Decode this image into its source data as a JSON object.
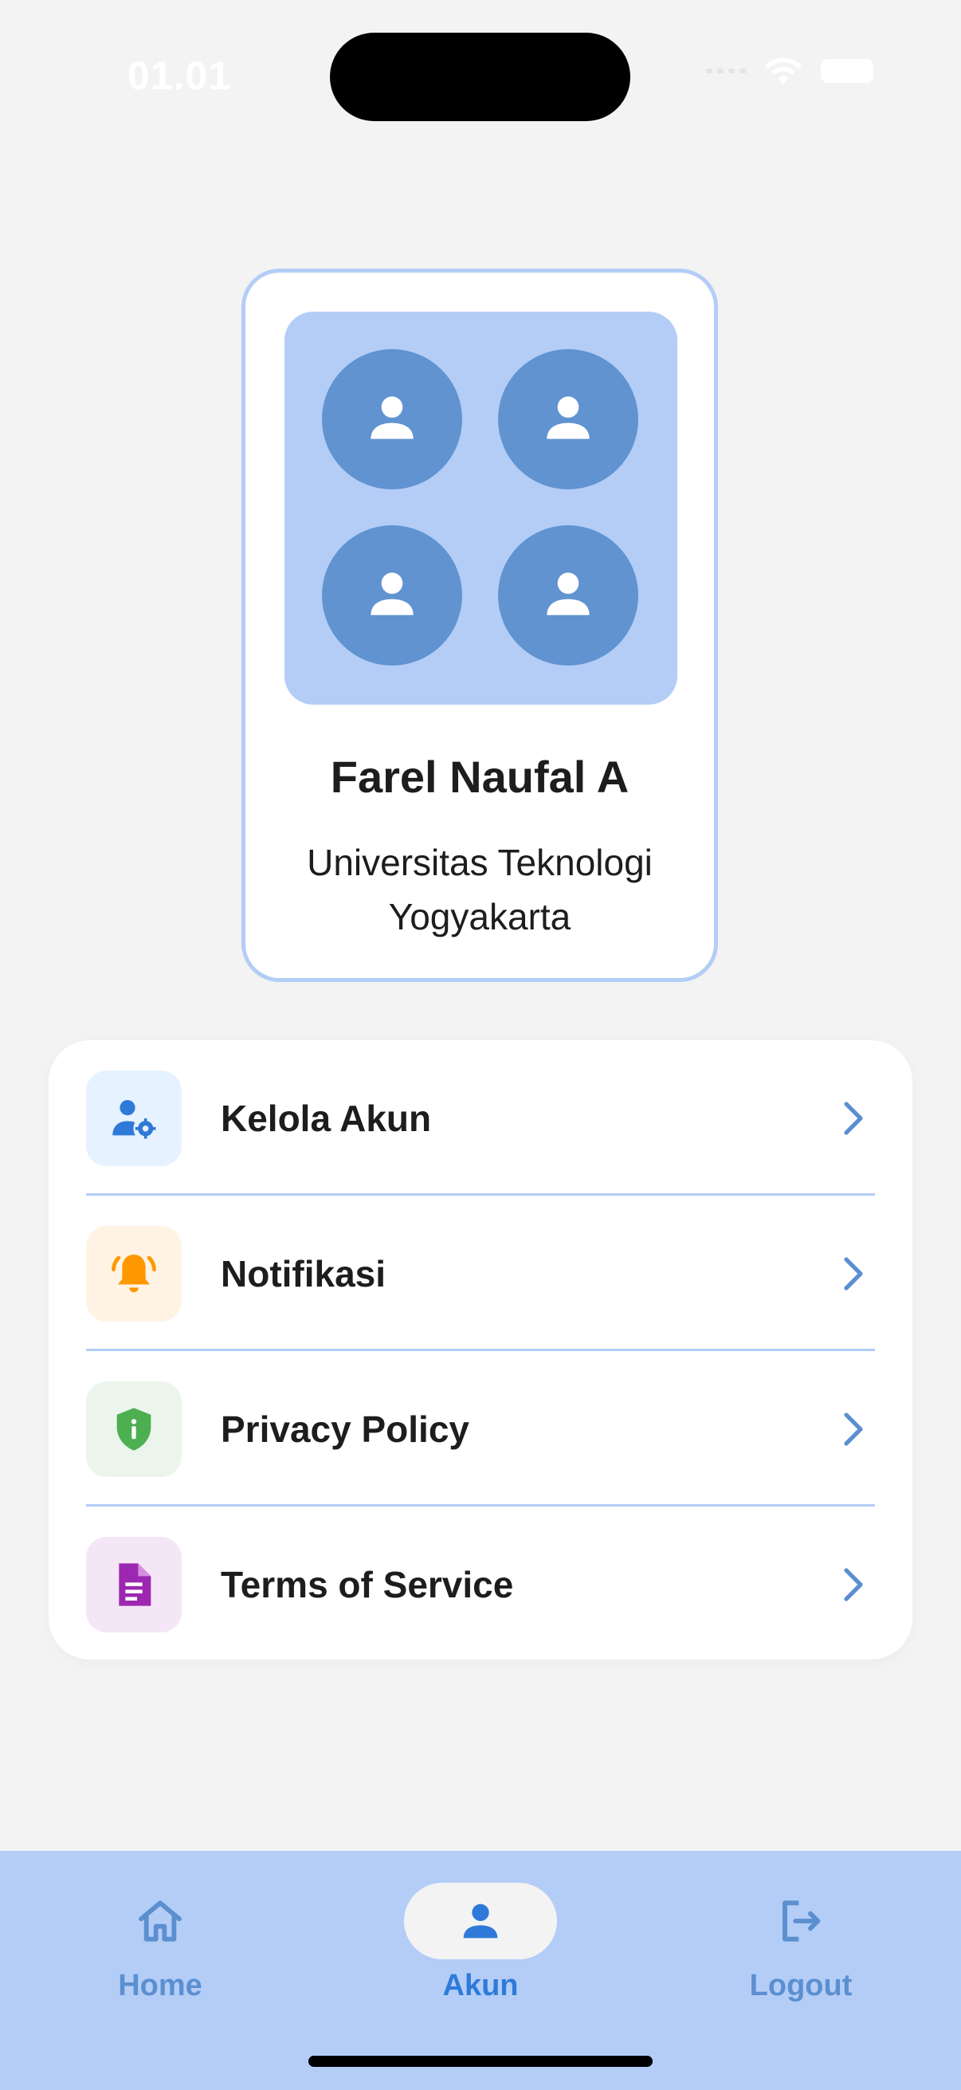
{
  "status_bar": {
    "time": "01.01"
  },
  "profile": {
    "name": "Farel Naufal A",
    "organization": "Universitas Teknologi Yogyakarta"
  },
  "menu": {
    "items": [
      {
        "label": "Kelola Akun",
        "icon": "manage-account-icon",
        "icon_color": "#2f7ad9",
        "bg_color": "#e6f2ff"
      },
      {
        "label": "Notifikasi",
        "icon": "bell-ringing-icon",
        "icon_color": "#ff9800",
        "bg_color": "#fff3e3"
      },
      {
        "label": "Privacy Policy",
        "icon": "shield-info-icon",
        "icon_color": "#4caf50",
        "bg_color": "#ebf5ec"
      },
      {
        "label": "Terms of Service",
        "icon": "document-icon",
        "icon_color": "#9c27b0",
        "bg_color": "#f5e6f7"
      }
    ]
  },
  "bottom_nav": {
    "items": [
      {
        "label": "Home",
        "icon": "home-icon",
        "active": false
      },
      {
        "label": "Akun",
        "icon": "person-icon",
        "active": true
      },
      {
        "label": "Logout",
        "icon": "logout-icon",
        "active": false
      }
    ]
  },
  "colors": {
    "accent": "#b3cdf7",
    "avatar": "#6093d0",
    "chevron": "#5b8fd0",
    "background": "#f3f3f3"
  }
}
